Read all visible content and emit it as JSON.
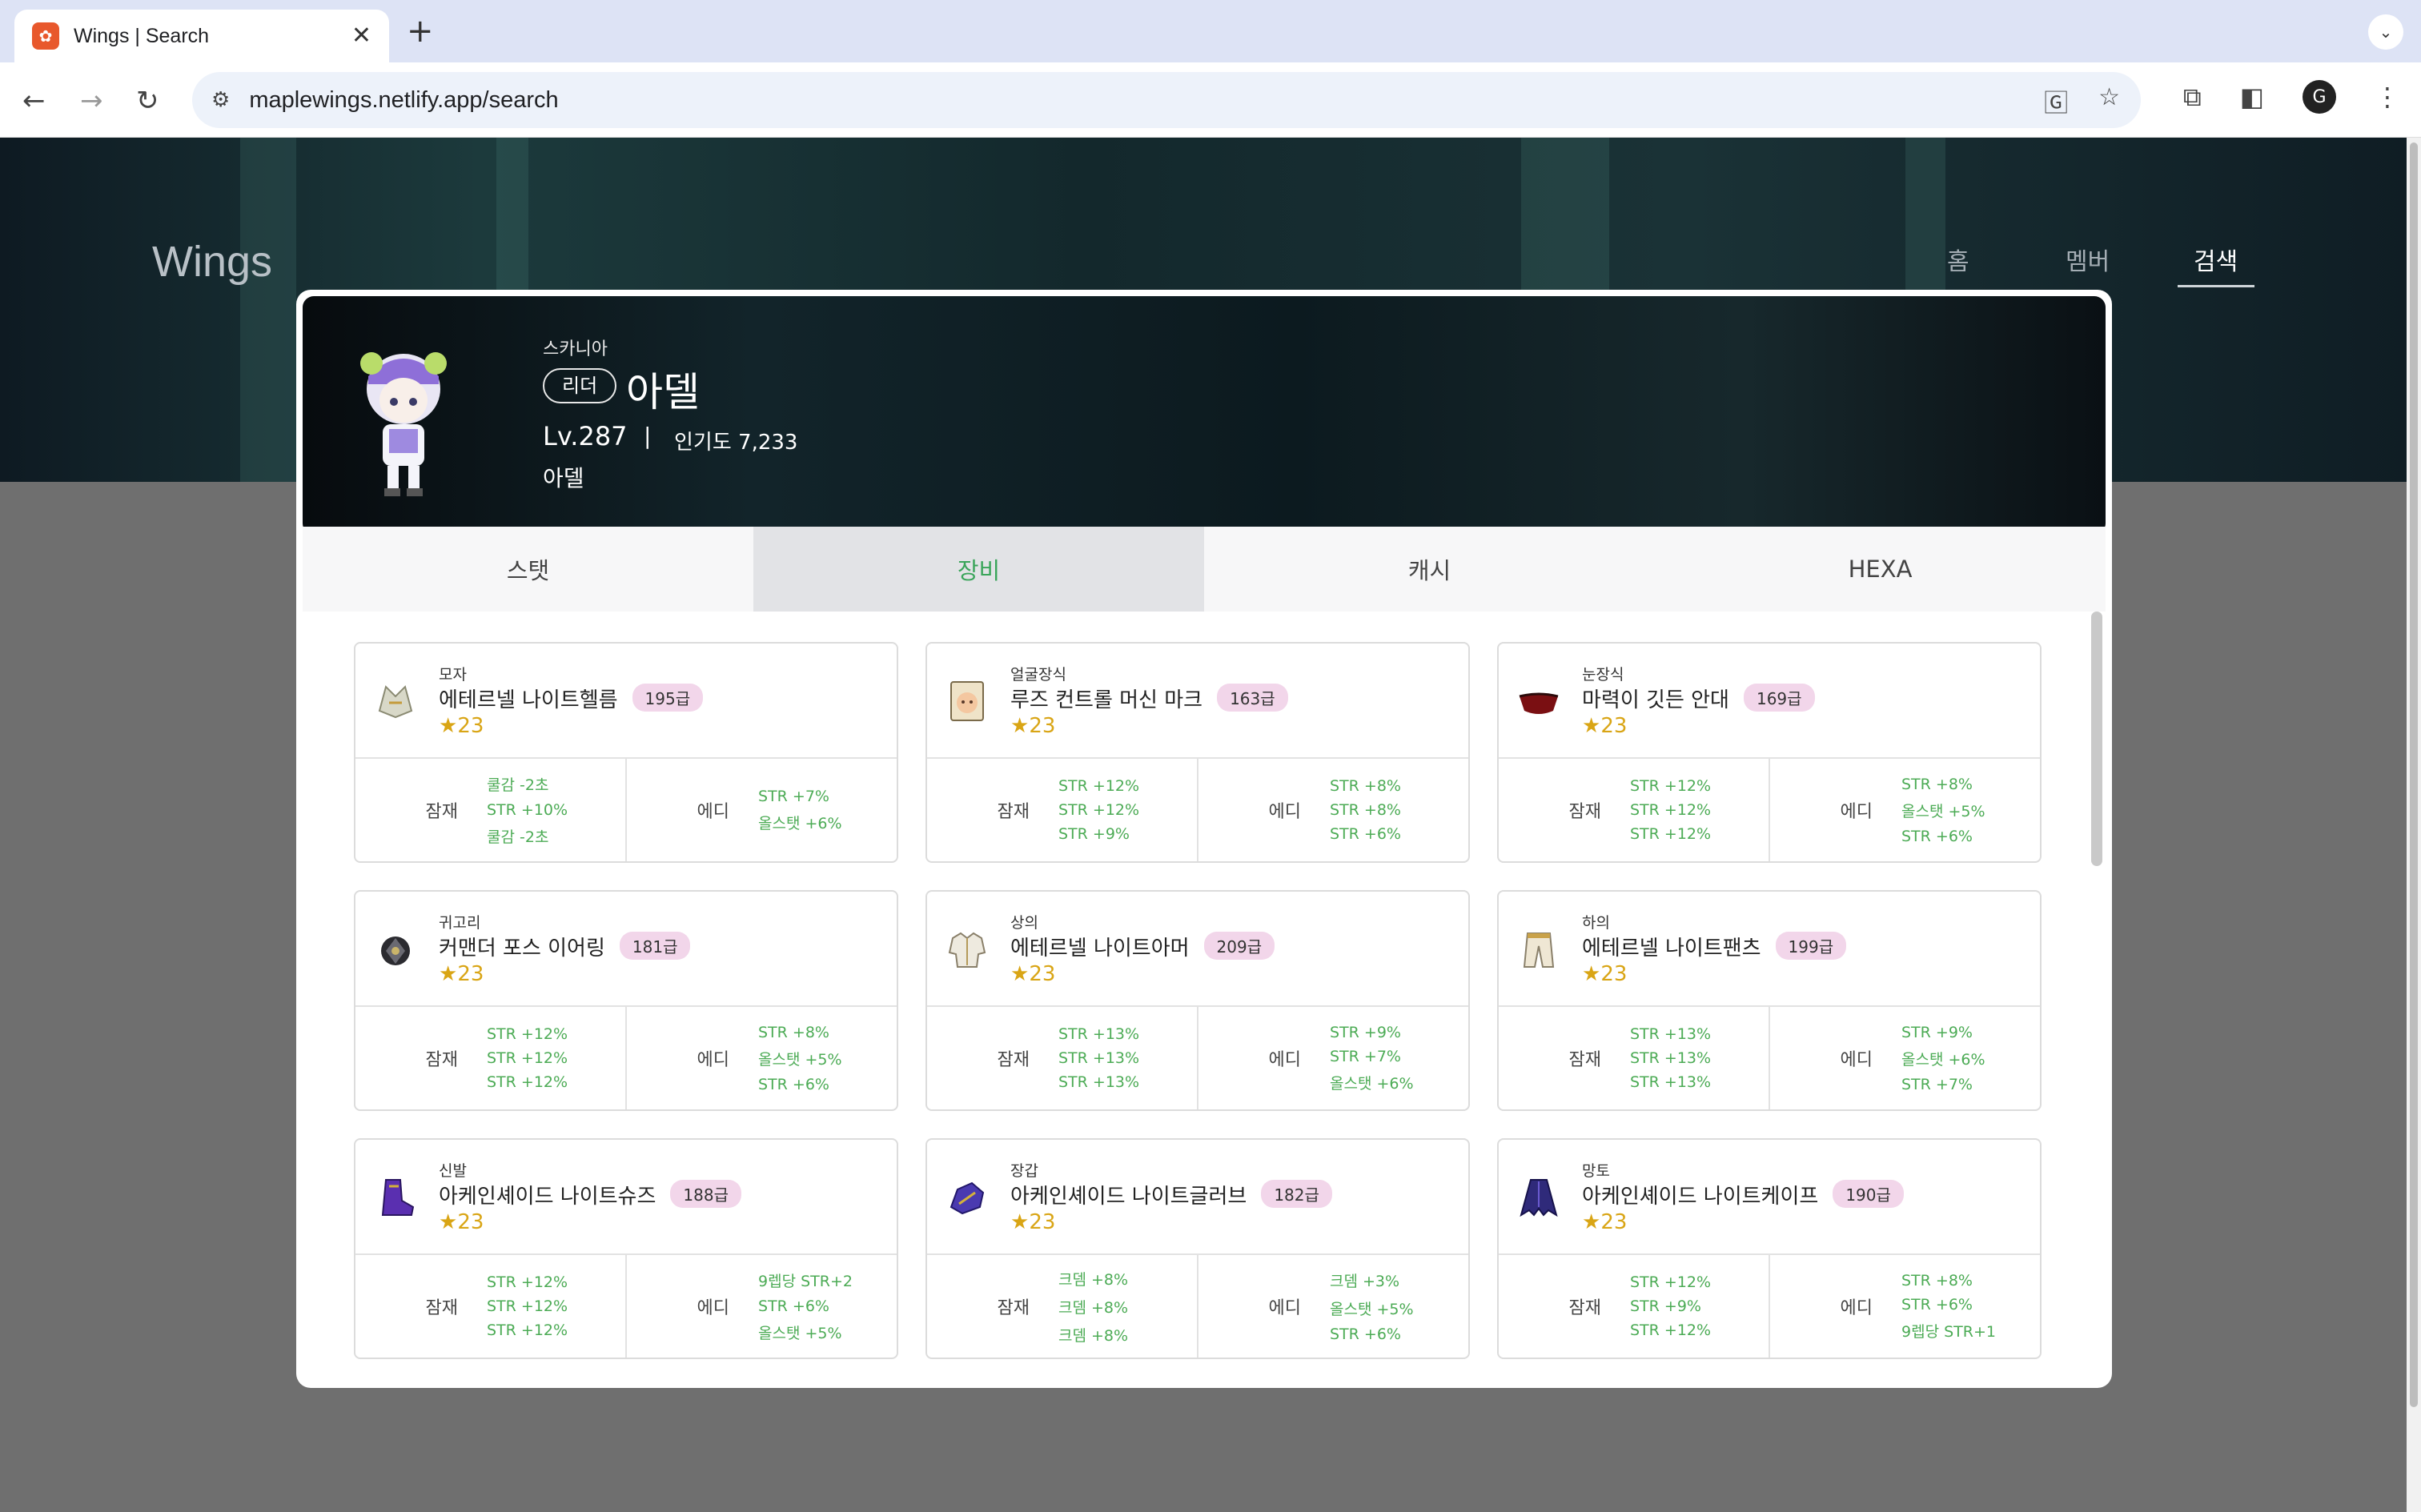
{
  "browser": {
    "tab_title": "Wings | Search",
    "url": "maplewings.netlify.app/search"
  },
  "site": {
    "brand": "Wings",
    "nav": [
      {
        "label": "홈"
      },
      {
        "label": "멤버"
      },
      {
        "label": "검색"
      }
    ],
    "active_nav": "검색"
  },
  "character": {
    "world": "스카니아",
    "role": "리더",
    "name": "아델",
    "level": "Lv.287",
    "separator": "|",
    "fame": "인기도 7,233",
    "guild": "아델"
  },
  "tabs": [
    {
      "label": "스탯"
    },
    {
      "label": "장비"
    },
    {
      "label": "캐시"
    },
    {
      "label": "HEXA"
    }
  ],
  "active_tab": "장비",
  "colors": {
    "option_text": "#4cab55",
    "active_tab": "#3aa55a",
    "star": "#d9a515",
    "level_badge": "#f2d6ea"
  },
  "equipment": [
    {
      "type": "모자",
      "name": "에테르넬 나이트헬름",
      "level": "195급",
      "stars": "23",
      "icon": "helmet-icon",
      "potential_label": "잠재",
      "potential": [
        "쿨감 -2초",
        "STR +10%",
        "쿨감 -2초"
      ],
      "additional_label": "에디",
      "additional": [
        "STR +7%",
        "올스탯 +6%"
      ]
    },
    {
      "type": "얼굴장식",
      "name": "루즈 컨트롤 머신 마크",
      "level": "163급",
      "stars": "23",
      "icon": "face-accessory-icon",
      "potential_label": "잠재",
      "potential": [
        "STR +12%",
        "STR +12%",
        "STR +9%"
      ],
      "additional_label": "에디",
      "additional": [
        "STR +8%",
        "STR +8%",
        "STR +6%"
      ]
    },
    {
      "type": "눈장식",
      "name": "마력이 깃든 안대",
      "level": "169급",
      "stars": "23",
      "icon": "eye-patch-icon",
      "potential_label": "잠재",
      "potential": [
        "STR +12%",
        "STR +12%",
        "STR +12%"
      ],
      "additional_label": "에디",
      "additional": [
        "STR +8%",
        "올스탯 +5%",
        "STR +6%"
      ]
    },
    {
      "type": "귀고리",
      "name": "커맨더 포스 이어링",
      "level": "181급",
      "stars": "23",
      "icon": "earring-icon",
      "potential_label": "잠재",
      "potential": [
        "STR +12%",
        "STR +12%",
        "STR +12%"
      ],
      "additional_label": "에디",
      "additional": [
        "STR +8%",
        "올스탯 +5%",
        "STR +6%"
      ]
    },
    {
      "type": "상의",
      "name": "에테르넬 나이트아머",
      "level": "209급",
      "stars": "23",
      "icon": "armor-icon",
      "potential_label": "잠재",
      "potential": [
        "STR +13%",
        "STR +13%",
        "STR +13%"
      ],
      "additional_label": "에디",
      "additional": [
        "STR +9%",
        "STR +7%",
        "올스탯 +6%"
      ]
    },
    {
      "type": "하의",
      "name": "에테르넬 나이트팬츠",
      "level": "199급",
      "stars": "23",
      "icon": "pants-icon",
      "potential_label": "잠재",
      "potential": [
        "STR +13%",
        "STR +13%",
        "STR +13%"
      ],
      "additional_label": "에디",
      "additional": [
        "STR +9%",
        "올스탯 +6%",
        "STR +7%"
      ]
    },
    {
      "type": "신발",
      "name": "아케인셰이드 나이트슈즈",
      "level": "188급",
      "stars": "23",
      "icon": "shoes-icon",
      "potential_label": "잠재",
      "potential": [
        "STR +12%",
        "STR +12%",
        "STR +12%"
      ],
      "additional_label": "에디",
      "additional": [
        "9렙당 STR+2",
        "STR +6%",
        "올스탯 +5%"
      ]
    },
    {
      "type": "장갑",
      "name": "아케인셰이드 나이트글러브",
      "level": "182급",
      "stars": "23",
      "icon": "glove-icon",
      "potential_label": "잠재",
      "potential": [
        "크뎀 +8%",
        "크뎀 +8%",
        "크뎀 +8%"
      ],
      "additional_label": "에디",
      "additional": [
        "크뎀 +3%",
        "올스탯 +5%",
        "STR +6%"
      ]
    },
    {
      "type": "망토",
      "name": "아케인셰이드 나이트케이프",
      "level": "190급",
      "stars": "23",
      "icon": "cape-icon",
      "potential_label": "잠재",
      "potential": [
        "STR +12%",
        "STR +9%",
        "STR +12%"
      ],
      "additional_label": "에디",
      "additional": [
        "STR +8%",
        "STR +6%",
        "9렙당 STR+1"
      ]
    }
  ]
}
